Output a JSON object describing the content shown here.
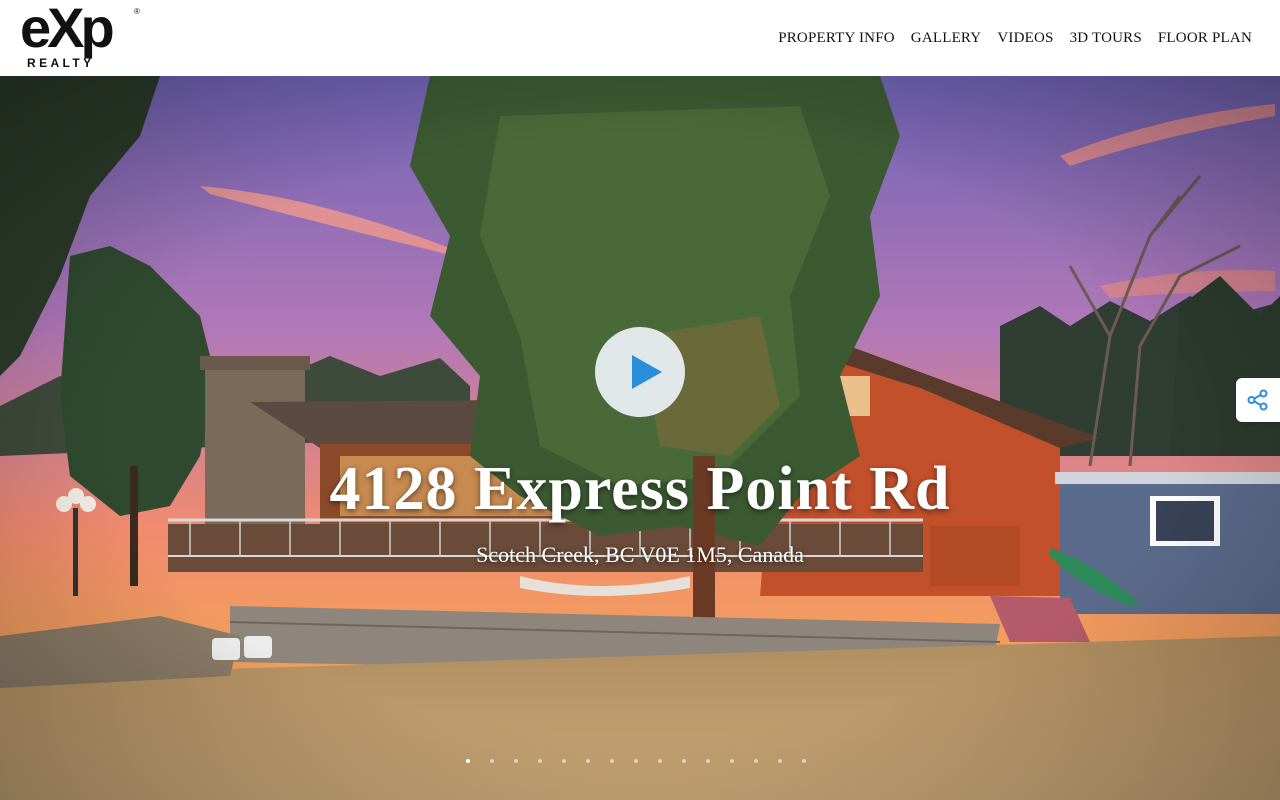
{
  "brand": {
    "logo_mark": "eXp",
    "logo_sub": "REALTY",
    "registered": "®"
  },
  "nav": {
    "items": [
      "PROPERTY INFO",
      "GALLERY",
      "VIDEOS",
      "3D TOURS",
      "FLOOR PLAN"
    ]
  },
  "hero": {
    "title": "4128 Express Point Rd",
    "subtitle": "Scotch Creek, BC V0E 1M5, Canada",
    "play_icon": "play-icon",
    "share_icon": "share-icon",
    "slide_count": 15,
    "active_slide": 1
  },
  "colors": {
    "accent": "#2a8fd8",
    "header_bg": "#ffffff",
    "text": "#111111"
  }
}
